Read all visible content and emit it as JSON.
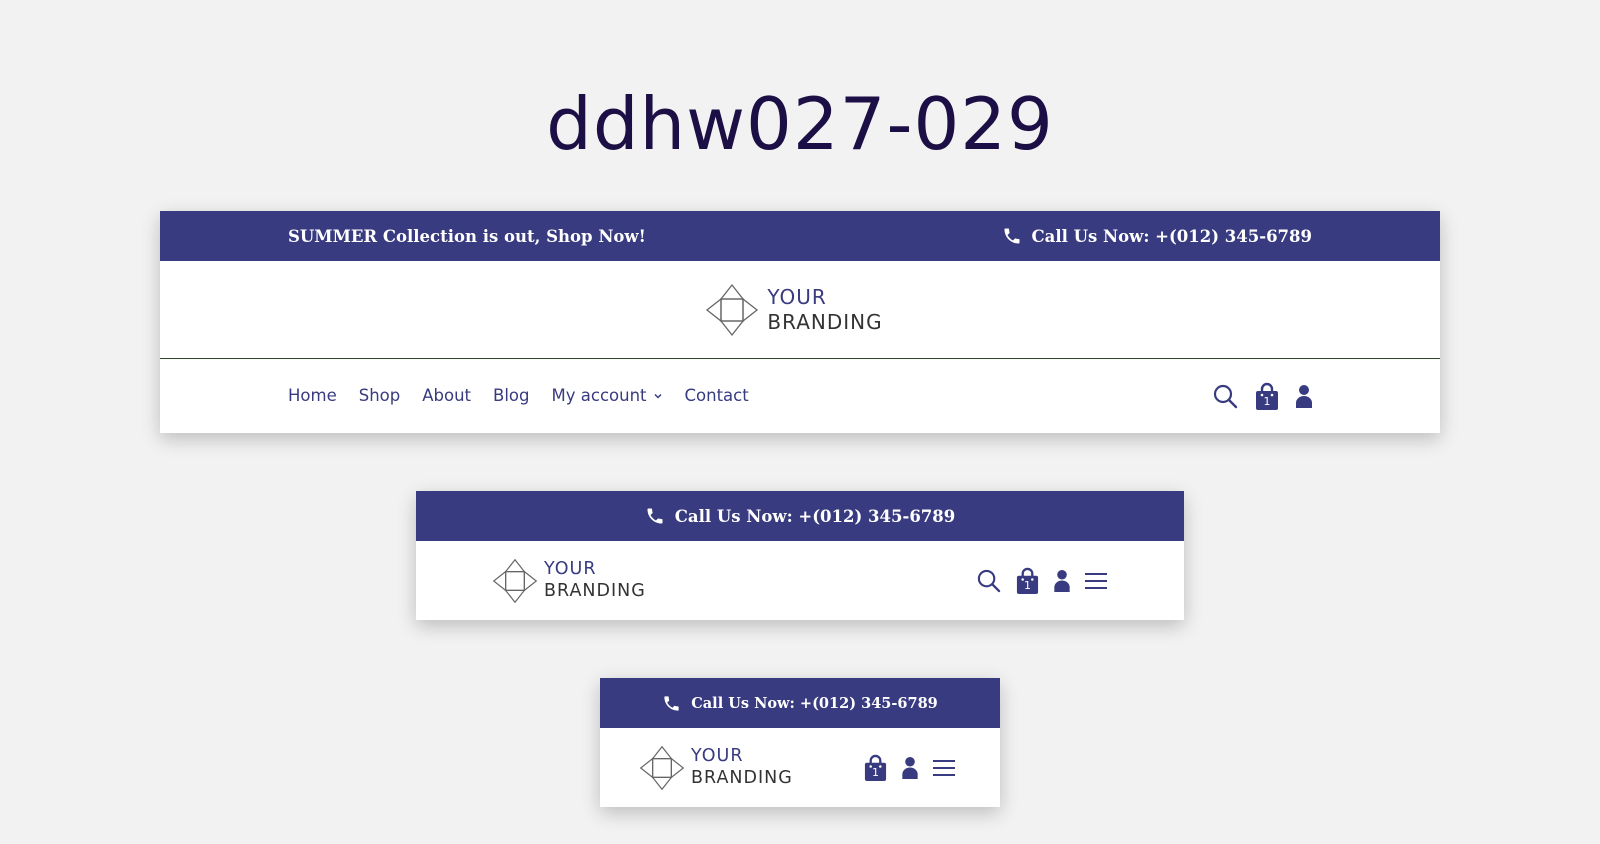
{
  "page": {
    "title": "ddhw027-029"
  },
  "header_desktop": {
    "announcement": "SUMMER Collection is out, Shop Now!",
    "phone_text": "Call Us Now: +(012) 345-6789",
    "logo": {
      "line1": "YOUR",
      "line2": "BRANDING"
    },
    "nav": [
      {
        "label": "Home"
      },
      {
        "label": "Shop"
      },
      {
        "label": "About"
      },
      {
        "label": "Blog"
      },
      {
        "label": "My account"
      },
      {
        "label": "Contact"
      }
    ],
    "cart_count": "1"
  },
  "header_tablet": {
    "phone_text": "Call Us Now: +(012) 345-6789",
    "logo": {
      "line1": "YOUR",
      "line2": "BRANDING"
    },
    "cart_count": "1"
  },
  "header_mobile": {
    "phone_text": "Call Us Now: +(012) 345-6789",
    "logo": {
      "line1": "YOUR",
      "line2": "BRANDING"
    },
    "cart_count": "1"
  },
  "colors": {
    "brand": "#393b80",
    "title": "#1c0f45",
    "background": "#f2f2f2",
    "divider": "#2d4a2a"
  },
  "icons": [
    "phone-icon",
    "search-icon",
    "cart-bag-icon",
    "user-icon",
    "hamburger-menu-icon",
    "chevron-down-icon",
    "logo-mark-icon"
  ]
}
